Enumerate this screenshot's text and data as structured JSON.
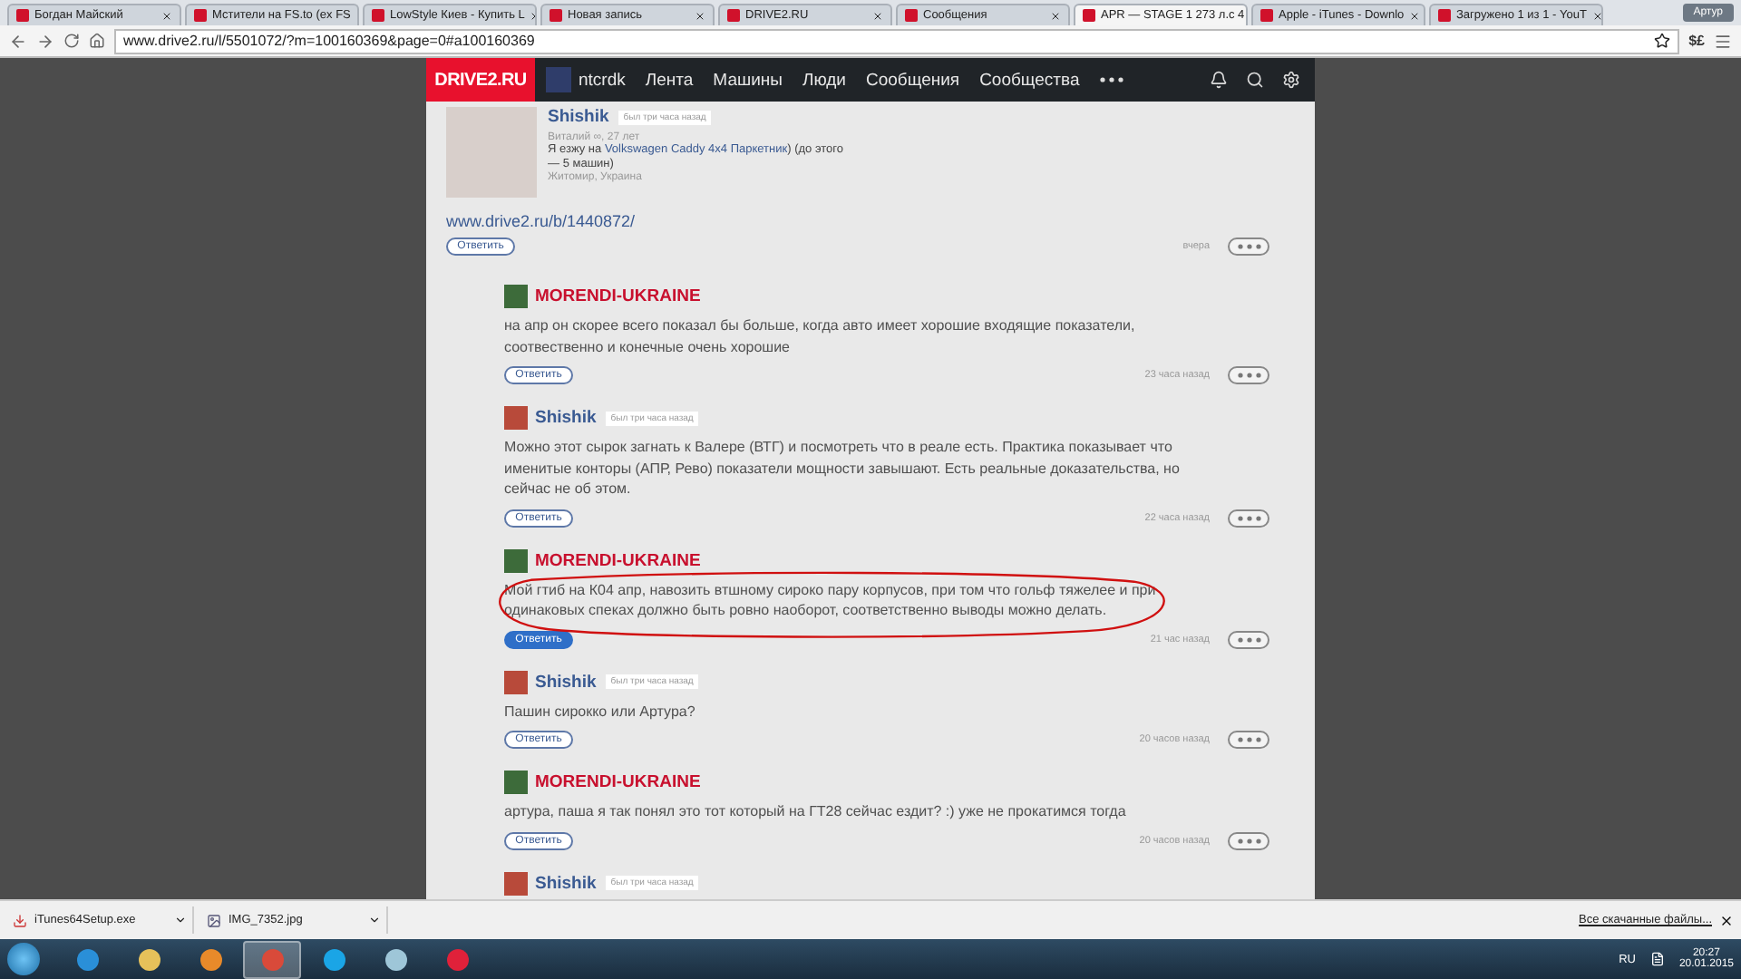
{
  "browser": {
    "tabs": [
      {
        "title": "Богдан Майский",
        "selected": false
      },
      {
        "title": "Мстители на FS.to (ex FS",
        "selected": false
      },
      {
        "title": "LowStyle Киев - Купить L",
        "selected": false
      },
      {
        "title": "Новая запись",
        "selected": false
      },
      {
        "title": "DRIVE2.RU",
        "selected": false
      },
      {
        "title": "Сообщения",
        "selected": false
      },
      {
        "title": "APR — STAGE 1 273 л.с 4",
        "selected": true
      },
      {
        "title": "Apple - iTunes - Downlo",
        "selected": false
      },
      {
        "title": "Загружено 1 из 1 - YouT",
        "selected": false
      }
    ],
    "user": "Артур",
    "extension": "$£",
    "url": "www.drive2.ru/l/5501072/?m=100160369&page=0#a100160369"
  },
  "site": {
    "logo": "DRIVE2.RU",
    "username": "ntcrdk",
    "nav": [
      "Лента",
      "Машины",
      "Люди",
      "Сообщения",
      "Сообщества"
    ]
  },
  "post": {
    "author": "Shishik",
    "status": "был три часа назад",
    "info": "Виталий ∞, 27 лет",
    "drives_prefix": "Я езжу на ",
    "car": "Volkswagen Caddy 4x4 Паркетник",
    "drives_suffix": ") (до этого —",
    "cars_count": "5 машин)",
    "location": "Житомир, Украина",
    "link": "www.drive2.ru/b/1440872/",
    "reply": "Ответить",
    "time": "вчера"
  },
  "comments": [
    {
      "author": "MORENDI-UKRAINE",
      "kind": "club",
      "text": "на апр он скорее всего показал бы больше, когда авто имеет хорошие входящие показатели, соотвественно и конечные очень хорошие",
      "reply": "Ответить",
      "reply_active": false,
      "time": "23 часа назад",
      "circled": false
    },
    {
      "author": "Shishik",
      "kind": "user",
      "status": "был три часа назад",
      "text": "Можно этот сырок загнать к Валере (ВТГ) и посмотреть что в реале есть. Практика показывает что именитые конторы (АПР, Рево) показатели мощности завышают. Есть реальные доказательства, но сейчас не об этом.",
      "reply": "Ответить",
      "reply_active": false,
      "time": "22 часа назад",
      "circled": false
    },
    {
      "author": "MORENDI-UKRAINE",
      "kind": "club",
      "text": "Мой гтиб на К04 апр, навозить втшному сироко пару корпусов, при том что гольф тяжелее и при одинаковых спеках должно быть ровно наоборот, соответственно выводы можно делать.",
      "reply": "Ответить",
      "reply_active": true,
      "time": "21 час назад",
      "circled": true
    },
    {
      "author": "Shishik",
      "kind": "user",
      "status": "был три часа назад",
      "text": "Пашин сирокко или Артура?",
      "reply": "Ответить",
      "reply_active": false,
      "time": "20 часов назад",
      "circled": false
    },
    {
      "author": "MORENDI-UKRAINE",
      "kind": "club",
      "text": "артура, паша я так понял это тот который на ГТ28 сейчас ездит? :) уже не прокатимся тогда",
      "reply": "Ответить",
      "reply_active": false,
      "time": "20 часов назад",
      "circled": false
    },
    {
      "author": "Shishik",
      "kind": "user",
      "status": "был три часа назад",
      "circled": false
    }
  ],
  "downloads": {
    "items": [
      "iTunes64Setup.exe",
      "IMG_7352.jpg"
    ],
    "all_link": "Все скачанные файлы..."
  },
  "taskbar": {
    "pinned": [
      {
        "kind": "browser",
        "active": false
      },
      {
        "kind": "folder",
        "active": false
      },
      {
        "kind": "player",
        "active": false
      },
      {
        "kind": "chrome",
        "active": true
      },
      {
        "kind": "messenger",
        "active": false
      },
      {
        "kind": "notes",
        "active": false
      },
      {
        "kind": "music",
        "active": false
      }
    ],
    "lang": "RU",
    "time": "20:27",
    "date": "20.01.2015"
  }
}
